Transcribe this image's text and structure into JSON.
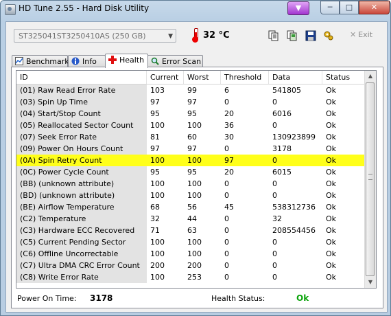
{
  "window": {
    "title": "HD Tune 2.55 - Hard Disk Utility"
  },
  "toolbar": {
    "drive": "ST325041ST3250410AS (250 GB)",
    "temperature": "32 °C",
    "exit_label": "Exit"
  },
  "tabs": [
    {
      "label": "Benchmark",
      "icon": "benchmark-icon"
    },
    {
      "label": "Info",
      "icon": "info-icon"
    },
    {
      "label": "Health",
      "icon": "health-cross-icon",
      "active": true
    },
    {
      "label": "Error Scan",
      "icon": "magnifier-icon"
    }
  ],
  "table": {
    "headers": [
      "ID",
      "Current",
      "Worst",
      "Threshold",
      "Data",
      "Status"
    ],
    "rows": [
      [
        "(01) Raw Read Error Rate",
        "103",
        "99",
        "6",
        "541805",
        "Ok"
      ],
      [
        "(03) Spin Up Time",
        "97",
        "97",
        "0",
        "0",
        "Ok"
      ],
      [
        "(04) Start/Stop Count",
        "95",
        "95",
        "20",
        "6016",
        "Ok"
      ],
      [
        "(05) Reallocated Sector Count",
        "100",
        "100",
        "36",
        "0",
        "Ok"
      ],
      [
        "(07) Seek Error Rate",
        "81",
        "60",
        "30",
        "130923899",
        "Ok"
      ],
      [
        "(09) Power On Hours Count",
        "97",
        "97",
        "0",
        "3178",
        "Ok"
      ],
      [
        "(0A) Spin Retry Count",
        "100",
        "100",
        "97",
        "0",
        "Ok"
      ],
      [
        "(0C) Power Cycle Count",
        "95",
        "95",
        "20",
        "6015",
        "Ok"
      ],
      [
        "(BB) (unknown attribute)",
        "100",
        "100",
        "0",
        "0",
        "Ok"
      ],
      [
        "(BD) (unknown attribute)",
        "100",
        "100",
        "0",
        "0",
        "Ok"
      ],
      [
        "(BE) Airflow Temperature",
        "68",
        "56",
        "45",
        "538312736",
        "Ok"
      ],
      [
        "(C2) Temperature",
        "32",
        "44",
        "0",
        "32",
        "Ok"
      ],
      [
        "(C3) Hardware ECC Recovered",
        "71",
        "63",
        "0",
        "208554456",
        "Ok"
      ],
      [
        "(C5) Current Pending Sector",
        "100",
        "100",
        "0",
        "0",
        "Ok"
      ],
      [
        "(C6) Offline Uncorrectable",
        "100",
        "100",
        "0",
        "0",
        "Ok"
      ],
      [
        "(C7) Ultra DMA CRC Error Count",
        "200",
        "200",
        "0",
        "0",
        "Ok"
      ],
      [
        "(C8) Write Error Rate",
        "100",
        "253",
        "0",
        "0",
        "Ok"
      ]
    ],
    "highlighted_row": 6,
    "highlight_color": "#ffff1a"
  },
  "footer": {
    "power_on_label": "Power On Time:",
    "power_on_value": "3178",
    "health_label": "Health Status:",
    "health_value": "Ok",
    "health_color": "#0aa40a"
  }
}
